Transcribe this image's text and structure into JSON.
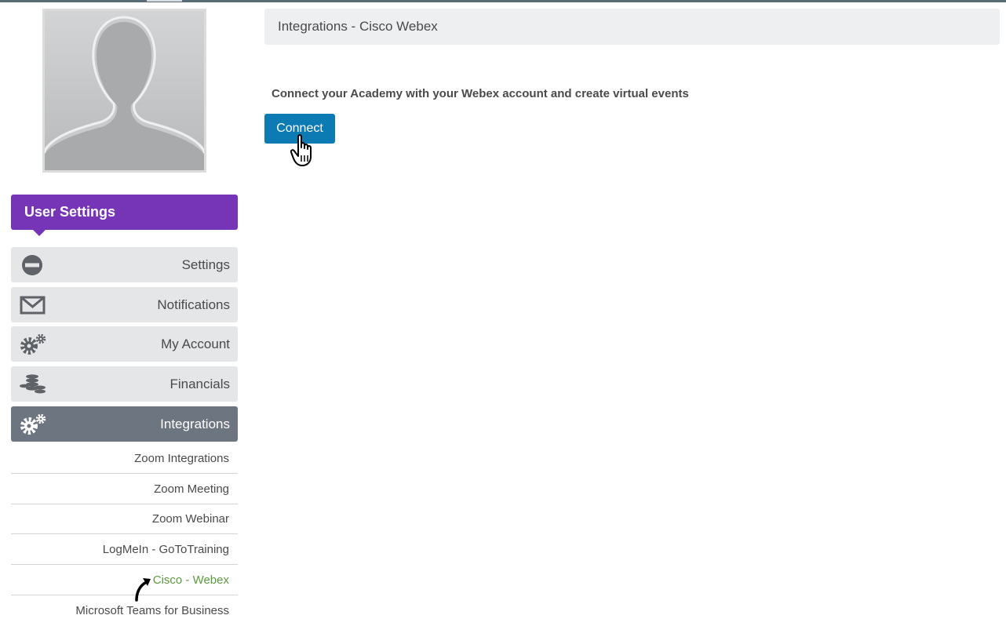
{
  "page": {
    "breadcrumb": "Integrations - Cisco Webex",
    "description": "Connect your Academy with your Webex account and create virtual events",
    "connect_label": "Connect"
  },
  "sidebar": {
    "header": "User Settings",
    "items": [
      {
        "label": "Settings",
        "icon": "minus-circle-icon",
        "active": false
      },
      {
        "label": "Notifications",
        "icon": "envelope-icon",
        "active": false
      },
      {
        "label": "My Account",
        "icon": "gears-icon",
        "active": false
      },
      {
        "label": "Financials",
        "icon": "coins-icon",
        "active": false
      },
      {
        "label": "Integrations",
        "icon": "gears-icon",
        "active": true
      }
    ],
    "subitems": [
      {
        "label": "Zoom Integrations"
      },
      {
        "label": "Zoom Meeting"
      },
      {
        "label": "Zoom Webinar"
      },
      {
        "label": "LogMeIn - GoToTraining"
      },
      {
        "label": "Cisco - Webex",
        "current": true
      },
      {
        "label": "Microsoft Teams for Business"
      }
    ]
  },
  "colors": {
    "header_purple": "#7535b6",
    "active_item": "#6d7580",
    "connect_button": "#0d7bb3",
    "current_subitem": "#5a9a3e"
  }
}
